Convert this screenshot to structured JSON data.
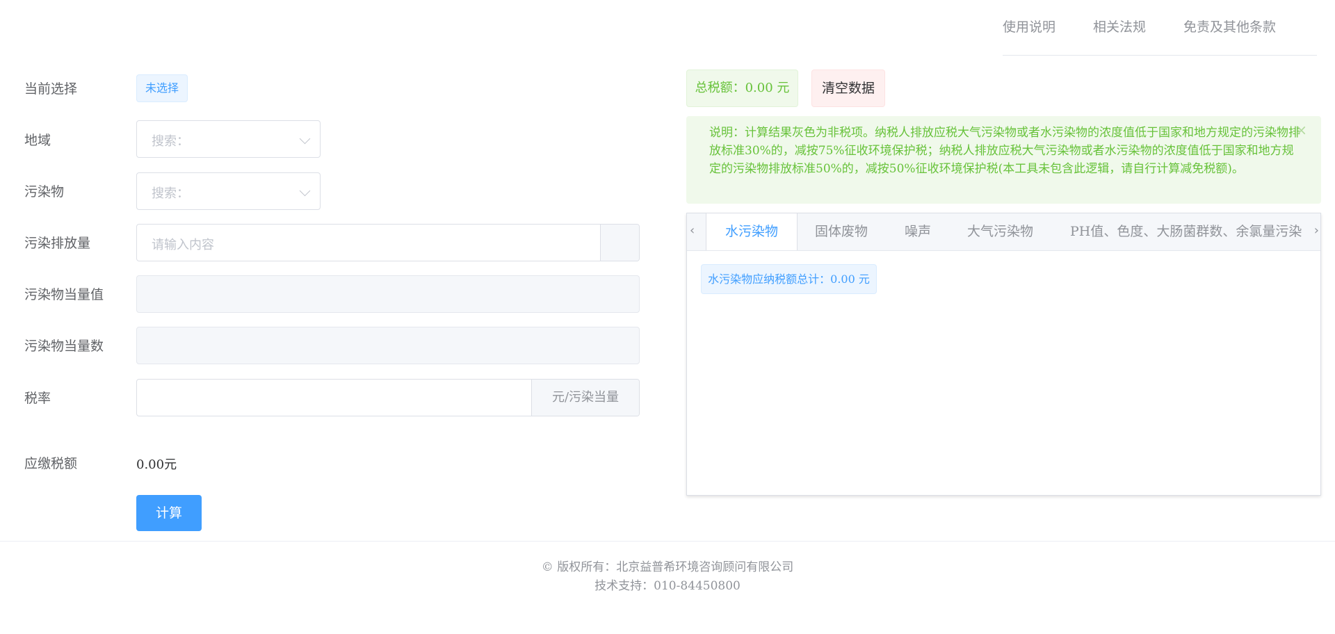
{
  "nav": {
    "items": [
      "使用说明",
      "相关法规",
      "免责及其他条款"
    ]
  },
  "form": {
    "current_selection_label": "当前选择",
    "current_selection_tag": "未选择",
    "region_label": "地域",
    "region_placeholder": "搜索：",
    "pollutant_label": "污染物",
    "pollutant_placeholder": "搜索：",
    "emission_label": "污染排放量",
    "emission_placeholder": "请输入内容",
    "equivalent_value_label": "污染物当量值",
    "equivalent_count_label": "污染物当量数",
    "tax_rate_label": "税率",
    "tax_rate_unit": "元/污染当量",
    "tax_due_label": "应缴税额",
    "tax_due_value": "0.00元",
    "calculate_button": "计算"
  },
  "summary": {
    "total_tax": "总税额：0.00 元",
    "clear_button": "清空数据",
    "alert_text": "说明：计算结果灰色为非税项。纳税人排放应税大气污染物或者水污染物的浓度值低于国家和地方规定的污染物排放标准30%的，减按75%征收环境保护税；纳税人排放应税大气污染物或者水污染物的浓度值低于国家和地方规定的污染物排放标准50%的，减按50%征收环境保护税(本工具未包含此逻辑，请自行计算减免税额)。",
    "alert_close": "×"
  },
  "tabs": {
    "items": [
      "水污染物",
      "固体废物",
      "噪声",
      "大气污染物",
      "PH值、色度、大肠菌群数、余氯量污染"
    ],
    "active_index": 0,
    "prev_arrow": "‹",
    "next_arrow": "›",
    "water_total": "水污染物应纳税额总计：0.00 元"
  },
  "footer": {
    "copyright": "© 版权所有：北京益普希环境咨询顾问有限公司",
    "support": "技术支持：010-84450800"
  },
  "colors": {
    "primary": "#409eff",
    "success": "#67c23a",
    "danger_bg": "#fef0f0"
  }
}
